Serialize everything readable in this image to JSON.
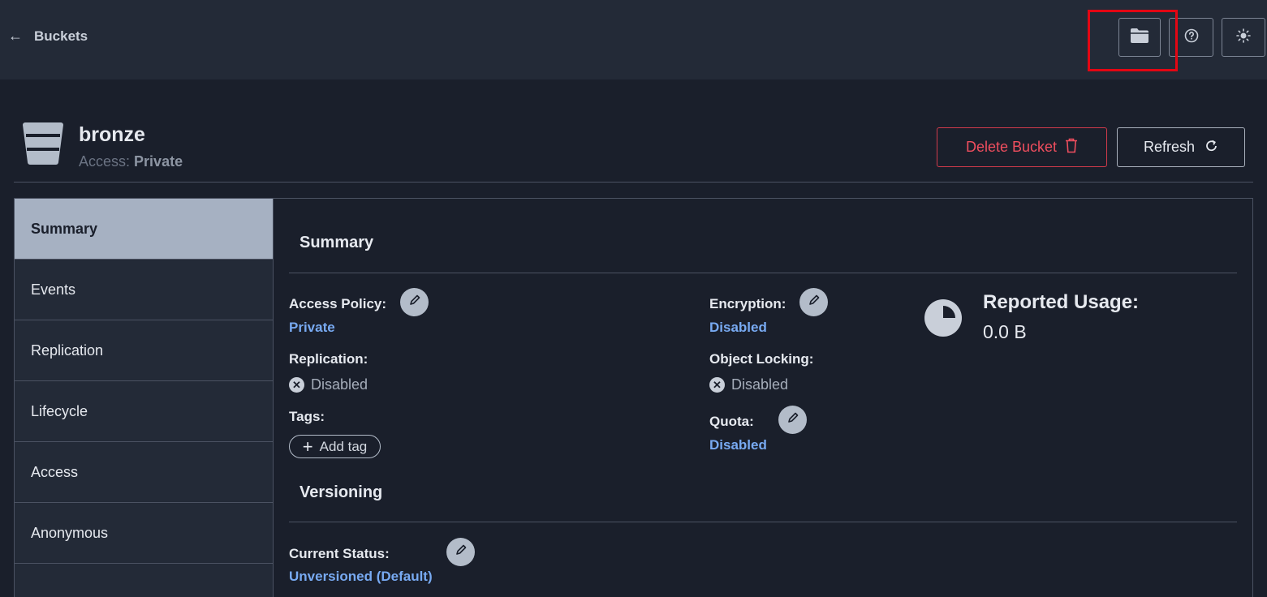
{
  "topbar": {
    "back_label": "Buckets",
    "icons": [
      "folder-icon",
      "help-icon",
      "theme-sun-icon"
    ],
    "highlight_color": "#e30613"
  },
  "bucket": {
    "name": "bronze",
    "access_label": "Access:",
    "access_value": "Private"
  },
  "actions": {
    "delete_label": "Delete Bucket",
    "refresh_label": "Refresh"
  },
  "sidebar": {
    "items": [
      {
        "label": "Summary",
        "active": true
      },
      {
        "label": "Events"
      },
      {
        "label": "Replication"
      },
      {
        "label": "Lifecycle"
      },
      {
        "label": "Access"
      },
      {
        "label": "Anonymous"
      }
    ]
  },
  "summary": {
    "title": "Summary",
    "access_policy": {
      "label": "Access Policy:",
      "value": "Private"
    },
    "replication": {
      "label": "Replication:",
      "value": "Disabled"
    },
    "tags": {
      "label": "Tags:",
      "add_label": "Add tag"
    },
    "encryption": {
      "label": "Encryption:",
      "value": "Disabled"
    },
    "object_locking": {
      "label": "Object Locking:",
      "value": "Disabled"
    },
    "quota": {
      "label": "Quota:",
      "value": "Disabled"
    },
    "usage": {
      "label": "Reported Usage:",
      "value": "0.0 B"
    }
  },
  "versioning": {
    "title": "Versioning",
    "current_status": {
      "label": "Current Status:",
      "value": "Unversioned (Default)"
    }
  },
  "colors": {
    "accent_link": "#78aaf2",
    "danger": "#ef4e5e",
    "active_tab_bg": "#a6b1c2"
  }
}
